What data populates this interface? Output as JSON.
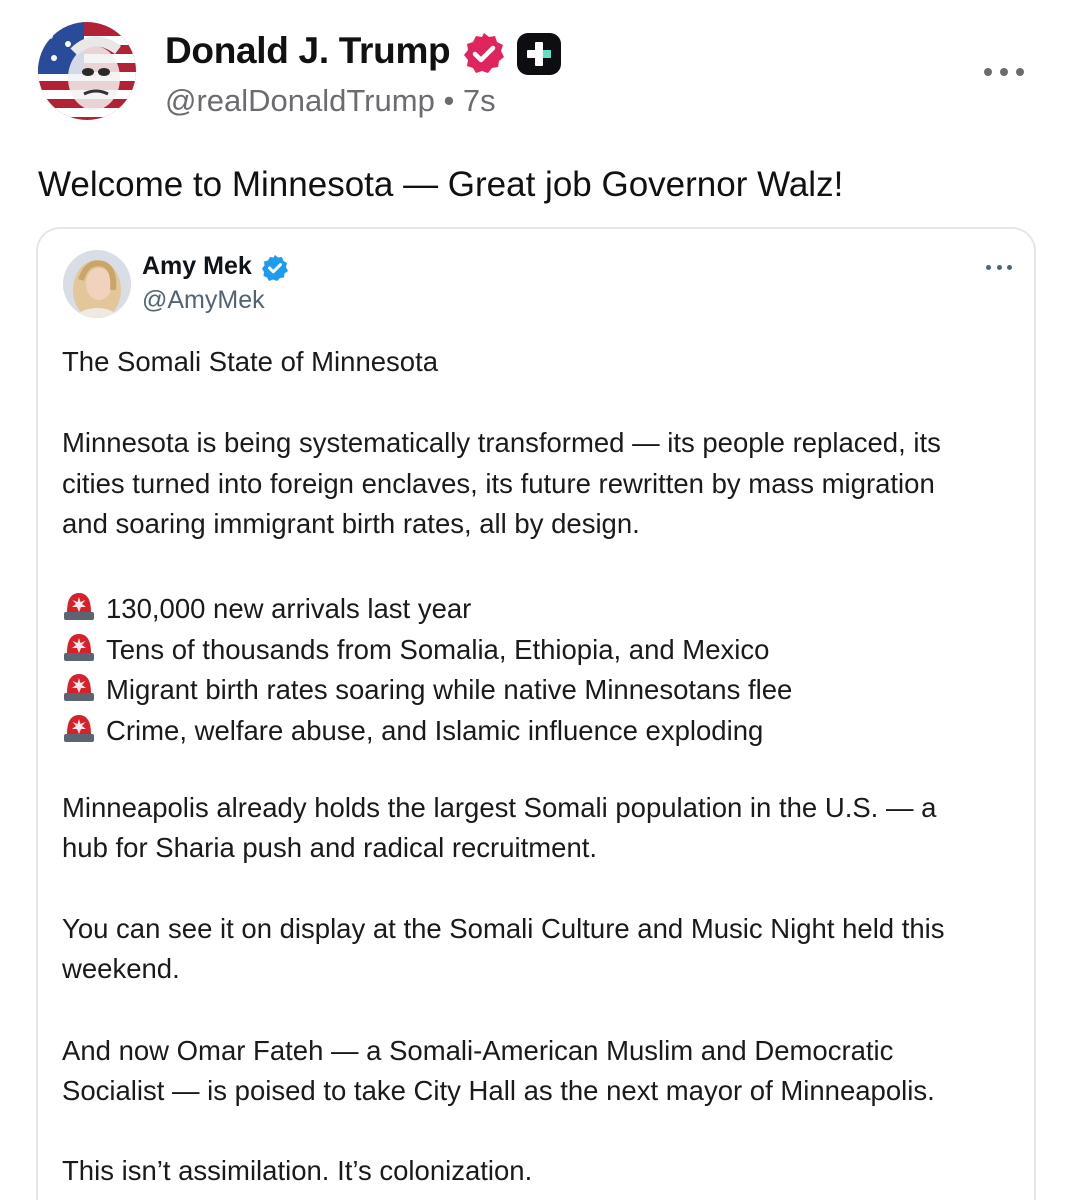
{
  "post": {
    "author_name": "Donald J. Trump",
    "handle": "@realDonaldTrump",
    "separator": "•",
    "time": "7s",
    "text": "Welcome to Minnesota — Great job Governor Walz!"
  },
  "quoted_post": {
    "author_name": "Amy Mek",
    "handle": "@AmyMek",
    "lines": {
      "title": "The Somali State of Minnesota",
      "p1_l1": "Minnesota is being systematically transformed — its people replaced, its",
      "p1_l2": "cities turned into foreign enclaves, its future rewritten by mass migration",
      "p1_l3": "and soaring immigrant birth rates, all by design.",
      "b1": "130,000 new arrivals last year",
      "b2": "Tens of thousands from Somalia, Ethiopia, and Mexico",
      "b3": "Migrant birth rates soaring while native Minnesotans flee",
      "b4": "Crime, welfare abuse, and Islamic influence exploding",
      "p2_l1": "Minneapolis already holds the largest Somali population in the U.S. — a",
      "p2_l2": "hub for Sharia push and radical recruitment.",
      "p3_l1": "You can see it on display at the Somali Culture and Music Night held this",
      "p3_l2": "weekend.",
      "p4_l1": "And now Omar Fateh — a Somali-American Muslim and Democratic",
      "p4_l2": "Socialist — is poised to take City Hall as the next mayor of Minneapolis.",
      "p5_l1": "This isn’t assimilation. It’s colonization."
    }
  },
  "icons": {
    "verified_main": "verified-badge-icon",
    "plus_badge": "plus-square-icon",
    "more": "more-options-icon",
    "siren": "police-siren-emoji-icon"
  },
  "colors": {
    "verified_main": "#e0245e",
    "verified_quote": "#1d9bf0",
    "secondary_text": "#6b6b70",
    "siren_red": "#d6202a"
  }
}
